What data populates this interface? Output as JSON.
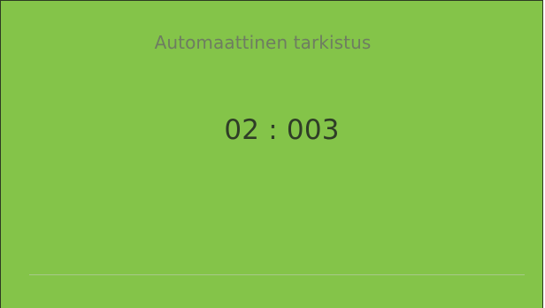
{
  "screen": {
    "title": "Automaattinen tarkistus",
    "timer": "02 : 003"
  },
  "colors": {
    "background": "#84c449",
    "title_text": "#6e7d61",
    "timer_text": "#2f3d27",
    "divider": "#a7c98a"
  }
}
